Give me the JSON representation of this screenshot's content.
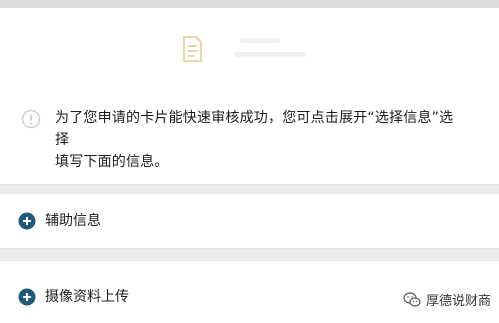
{
  "notice": {
    "line1": "为了您申请的卡片能快速审核成功，您可点击展开“选择信息”选择",
    "line2": "填写下面的信息。"
  },
  "sections": [
    {
      "label": "辅助信息",
      "icon": "plus-circle-icon"
    },
    {
      "label": "摄像资料上传",
      "icon": "plus-circle-icon"
    }
  ],
  "watermark": {
    "text": "厚德说财商",
    "icon": "wechat-icon"
  },
  "colors": {
    "accent": "#1f5a7a",
    "doc_icon": "#e8d7a8",
    "info_icon": "#cfcfcf",
    "background": "#ececec",
    "card": "#ffffff"
  }
}
